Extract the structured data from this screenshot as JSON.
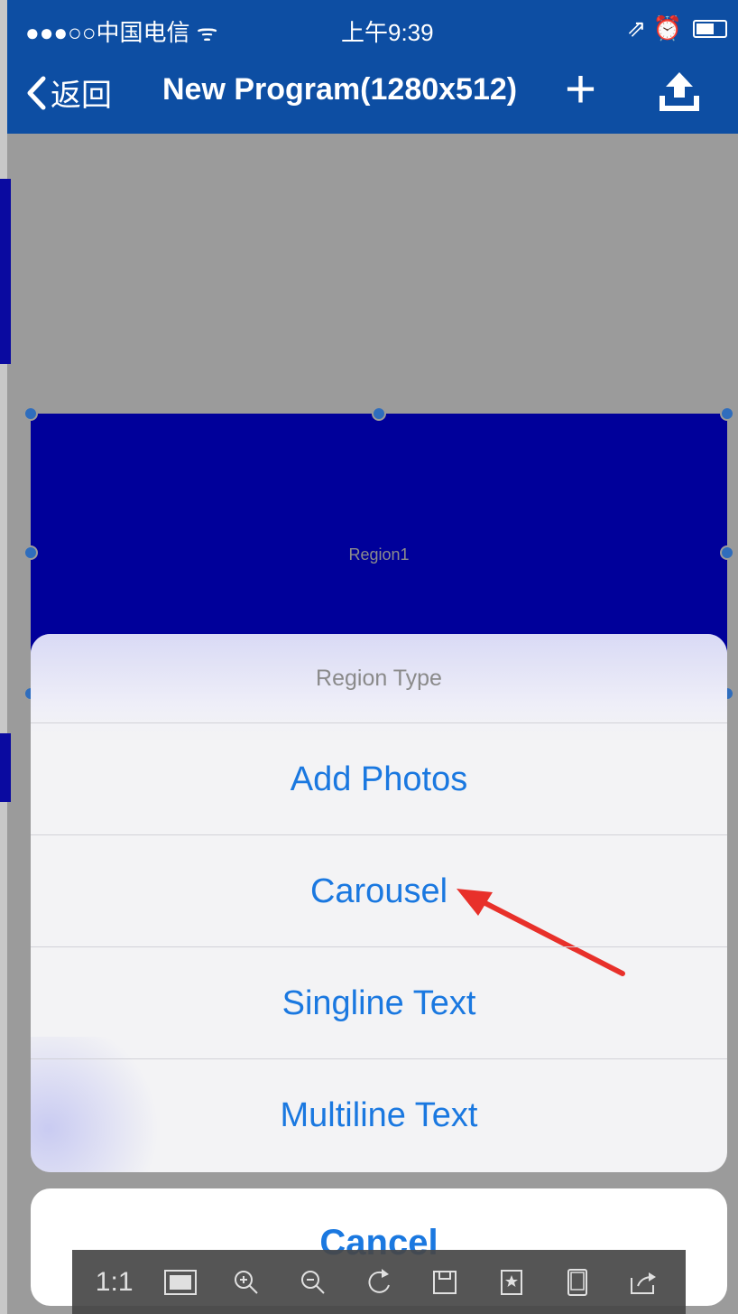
{
  "status_bar": {
    "carrier": "●●●○○中国电信 ᯤ",
    "time": "上午9:39",
    "indicators": "⇗ ⏰"
  },
  "nav": {
    "back_label": "返回",
    "title": "New Program(1280x512)",
    "plus": "+"
  },
  "canvas": {
    "region_label": "Region1",
    "region_color": "#00009a"
  },
  "action_sheet": {
    "header": "Region Type",
    "options": [
      "Add Photos",
      "Carousel",
      "Singline Text",
      "Multiline Text"
    ],
    "cancel": "Cancel"
  },
  "viewer_toolbar": {
    "actual_size": "1:1",
    "icons": [
      "fit-screen-icon",
      "zoom-in-icon",
      "zoom-out-icon",
      "rotate-icon",
      "save-icon",
      "bookmark-icon",
      "tablet-icon",
      "share-icon"
    ]
  },
  "colors": {
    "nav_blue": "#0d4ea3",
    "ios_blue": "#1a78e0",
    "annotation_red": "#e8302a"
  }
}
